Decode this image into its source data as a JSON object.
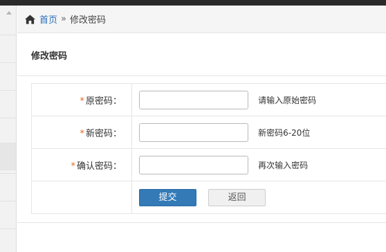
{
  "breadcrumb": {
    "home_label": "首页",
    "separator": "»",
    "current": "修改密码"
  },
  "panel": {
    "title": "修改密码"
  },
  "form": {
    "required_mark": "*",
    "fields": [
      {
        "label": "原密码：",
        "value": "",
        "hint": "请输入原始密码"
      },
      {
        "label": "新密码：",
        "value": "",
        "hint": "新密码6-20位"
      },
      {
        "label": "确认密码：",
        "value": "",
        "hint": "再次输入密码"
      }
    ],
    "submit_label": "提交",
    "back_label": "返回"
  },
  "colors": {
    "accent": "#337ab7",
    "required": "#e4681a",
    "link": "#2a6ebb"
  },
  "icons": {
    "breadcrumb_home": "home-icon"
  }
}
